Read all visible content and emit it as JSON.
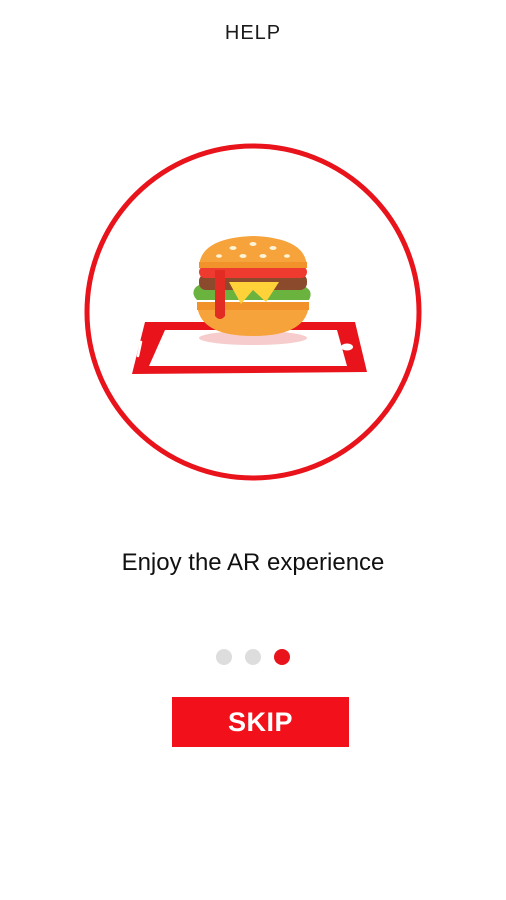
{
  "header": {
    "title": "HELP"
  },
  "hero": {
    "icon": "burger-on-phone-ar-icon",
    "ring_color": "#e8131b"
  },
  "caption": "Enjoy the AR experience",
  "pager": {
    "total": 3,
    "active_index": 2,
    "active_color": "#e8131b",
    "inactive_color": "#dddddd"
  },
  "skip_button": {
    "label": "SKIP",
    "color": "#f2111a"
  }
}
